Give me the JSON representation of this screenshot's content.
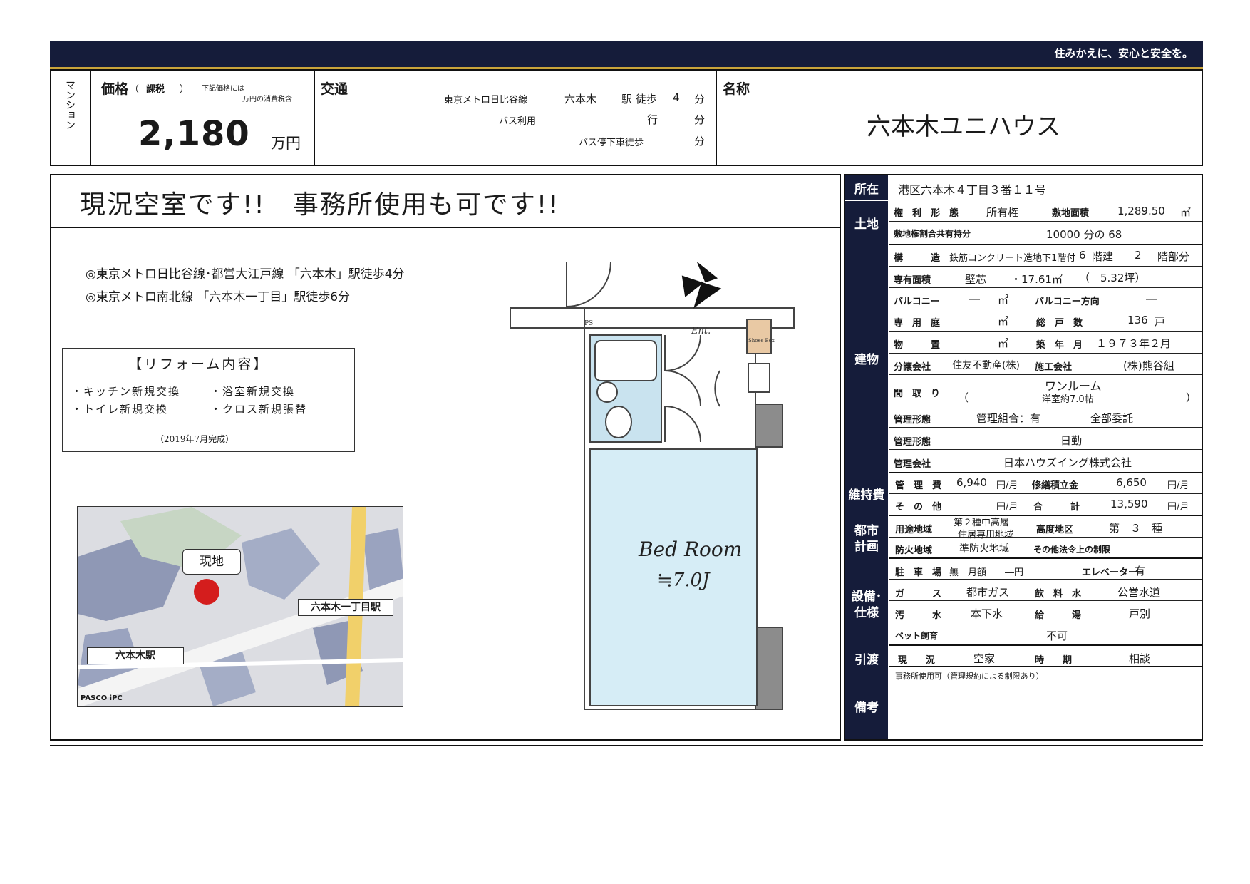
{
  "banner": {
    "tagline": "住みかえに、安心と安全を。"
  },
  "header": {
    "type_label": "マンション",
    "price": {
      "label": "価格",
      "tax_open": "（",
      "tax": "課税",
      "tax_close": "）",
      "tax_note_1": "下記価格には",
      "tax_note_2": "万円の消費税含",
      "value": "2,180",
      "unit": "万円"
    },
    "transport": {
      "label": "交通",
      "rows": [
        {
          "line": "東京メトロ日比谷線",
          "station": "六本木",
          "walk": "駅 徒歩",
          "minutes": "4",
          "unit": "分"
        },
        {
          "line": "バス利用",
          "station": "",
          "walk": "行",
          "minutes": "",
          "unit": "分"
        },
        {
          "line": "",
          "station": "",
          "walk": "バス停下車徒歩",
          "minutes": "",
          "unit": "分"
        }
      ]
    },
    "name": {
      "label": "名称",
      "value": "六本木ユニハウス"
    }
  },
  "left": {
    "headline": "現況空室です!!　事務所使用も可です!!",
    "access": [
      "◎東京メトロ日比谷線･都営大江戸線 「六本木」駅徒歩4分",
      "◎東京メトロ南北線 「六本木一丁目」駅徒歩6分"
    ],
    "reform": {
      "title": "【リフォーム内容】",
      "items": [
        "・キッチン新規交換",
        "・浴室新規交換",
        "・トイレ新規交換",
        "・クロス新規張替"
      ],
      "note": "（2019年7月完成）"
    },
    "map": {
      "current": "現地",
      "station1": "六本木駅",
      "station2": "六本木一丁目駅",
      "credit": "PASCO iPC"
    },
    "floorplan": {
      "room": "Bed Room",
      "size": "≒7.0J",
      "ent": "Ent.",
      "ps": "PS",
      "shoes": "Shoes Box"
    }
  },
  "info": {
    "location": {
      "label": "所在",
      "value": "港区六本木４丁目３番１１号"
    },
    "land": {
      "label": "土地",
      "rights_label": "権　利　形　態",
      "rights": "所有権",
      "area_label": "敷地面積",
      "area": "1,289.50",
      "area_unit": "㎡",
      "share_label": "敷地権割合共有持分",
      "share": "10000 分の 68"
    },
    "building": {
      "label": "建物",
      "struct_label": "構　　　造",
      "struct": "鉄筋コンクリート造地下1階付",
      "floors": "6",
      "floors_unit": "階建",
      "floor": "2",
      "floor_unit": "階部分",
      "exclusive_label": "専有面積",
      "exclusive_type": "壁芯",
      "exclusive": "・17.61㎡",
      "tsubo": "（　5.32坪）",
      "balcony_label": "バルコニー",
      "balcony": "―",
      "balcony_unit": "㎡",
      "balcony_dir_label": "バルコニー方向",
      "balcony_dir": "―",
      "garden_label": "専　用　庭",
      "garden_unit": "㎡",
      "units_label": "総　戸　数",
      "units": "136",
      "units_unit": "戸",
      "storage_label": "物　　　置",
      "storage_unit": "㎡",
      "built_label": "築　年　月",
      "built": "１９７３年２月",
      "seller_label": "分譲会社",
      "seller": "住友不動産(株)",
      "constructor_label": "施工会社",
      "constructor": "(株)熊谷組",
      "layout_label": "間　取　り",
      "layout_open": "（",
      "layout_1": "ワンルーム",
      "layout_2": "洋室約7.0帖",
      "layout_close": "）",
      "mgmt_form_label": "管理形態",
      "mgmt_form": "管理組合：有",
      "mgmt_entrust": "全部委託",
      "mgmt_form2_label": "管理形態",
      "mgmt_form2": "日勤",
      "mgmt_company_label": "管理会社",
      "mgmt_company": "日本ハウズイング株式会社"
    },
    "fees": {
      "label": "維持費",
      "mgmt_label": "管　理　費",
      "mgmt": "6,940",
      "mgmt_unit": "円/月",
      "reserve_label": "修繕積立金",
      "reserve": "6,650",
      "reserve_unit": "円/月",
      "other_label": "そ　の　他",
      "other_unit": "円/月",
      "total_label": "合　　　計",
      "total": "13,590",
      "total_unit": "円/月"
    },
    "city": {
      "label_1": "都市",
      "label_2": "計画",
      "use_label": "用途地域",
      "use_1": "第２種中高層",
      "use_2": "住居専用地域",
      "height_label": "高度地区",
      "height": "第　３　種",
      "fire_label": "防火地域",
      "fire": "準防火地域",
      "other": "その他法令上の制限"
    },
    "facilities": {
      "label_1": "設備･",
      "label_2": "仕様",
      "parking_label": "駐　車　場",
      "parking": "無　月額　　―円",
      "elevator_label": "エレベーター",
      "elevator": "有",
      "gas_label": "ガ　　　ス",
      "gas": "都市ガス",
      "water_label": "飲　料　水",
      "water": "公営水道",
      "sewage_label": "汚　　　水",
      "sewage": "本下水",
      "hotwater_label": "給　　　湯",
      "hotwater": "戸別",
      "pet_label": "ペット飼育",
      "pet": "不可"
    },
    "handover": {
      "label": "引渡",
      "status_label": "現　　況",
      "status": "空家",
      "timing_label": "時　　期",
      "timing": "相談"
    },
    "remarks": {
      "label": "備考",
      "text": "事務所使用可（管理規約による制限あり）"
    }
  }
}
